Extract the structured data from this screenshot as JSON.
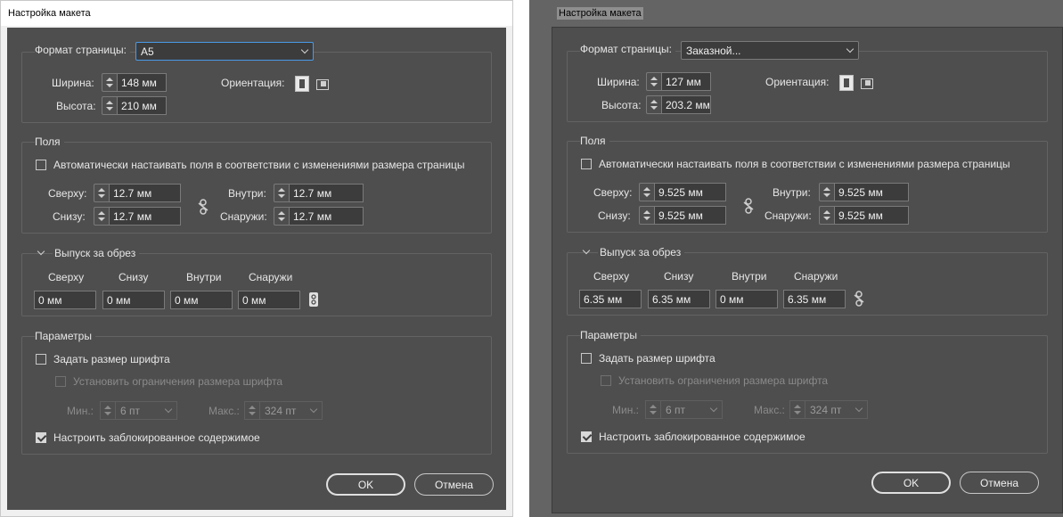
{
  "left": {
    "title": "Настройка макета",
    "page_format": {
      "label": "Формат страницы:",
      "value": "A5"
    },
    "width": {
      "label": "Ширина:",
      "value": "148 мм"
    },
    "height": {
      "label": "Высота:",
      "value": "210 мм"
    },
    "orientation": {
      "label": "Ориентация:"
    },
    "margins": {
      "title": "Поля",
      "auto_label": "Автоматически настаивать поля в соответствии с изменениями размера страницы",
      "top": {
        "label": "Сверху:",
        "value": "12.7 мм"
      },
      "bottom": {
        "label": "Снизу:",
        "value": "12.7 мм"
      },
      "inside": {
        "label": "Внутри:",
        "value": "12.7 мм"
      },
      "outside": {
        "label": "Снаружи:",
        "value": "12.7 мм"
      }
    },
    "bleed": {
      "title": "Выпуск за обрез",
      "cols": [
        "Сверху",
        "Снизу",
        "Внутри",
        "Снаружи"
      ],
      "values": [
        "0 мм",
        "0 мм",
        "0 мм",
        "0 мм"
      ]
    },
    "params": {
      "title": "Параметры",
      "set_font_size": "Задать размер шрифта",
      "limit_font": "Установить ограничения размера шрифта",
      "min_label": "Мин.:",
      "min_value": "6 пт",
      "max_label": "Макс.:",
      "max_value": "324 пт",
      "locked_content": "Настроить заблокированное содержимое"
    },
    "ok": "OK",
    "cancel": "Отмена"
  },
  "right": {
    "title": "Настройка макета",
    "page_format": {
      "label": "Формат страницы:",
      "value": "Заказной..."
    },
    "width": {
      "label": "Ширина:",
      "value": "127 мм"
    },
    "height": {
      "label": "Высота:",
      "value": "203.2 мм"
    },
    "orientation": {
      "label": "Ориентация:"
    },
    "margins": {
      "title": "Поля",
      "auto_label": "Автоматически настаивать поля в соответствии с изменениями размера страницы",
      "top": {
        "label": "Сверху:",
        "value": "9.525 мм"
      },
      "bottom": {
        "label": "Снизу:",
        "value": "9.525 мм"
      },
      "inside": {
        "label": "Внутри:",
        "value": "9.525 мм"
      },
      "outside": {
        "label": "Снаружи:",
        "value": "9.525 мм"
      }
    },
    "bleed": {
      "title": "Выпуск за обрез",
      "cols": [
        "Сверху",
        "Снизу",
        "Внутри",
        "Снаружи"
      ],
      "values": [
        "6.35 мм",
        "6.35 мм",
        "0 мм",
        "6.35 мм"
      ]
    },
    "params": {
      "title": "Параметры",
      "set_font_size": "Задать размер шрифта",
      "limit_font": "Установить ограничения размера шрифта",
      "min_label": "Мин.:",
      "min_value": "6 пт",
      "max_label": "Макс.:",
      "max_value": "324 пт",
      "locked_content": "Настроить заблокированное содержимое"
    },
    "ok": "OK",
    "cancel": "Отмена"
  },
  "icons": {
    "orientation_portrait": "portrait-orientation-icon",
    "orientation_landscape": "landscape-orientation-icon",
    "link": "chain-link-icon",
    "unlink": "broken-chain-icon"
  },
  "colors": {
    "panel": "#4e4e4e",
    "field": "#3c3c3c",
    "focus": "#4a9ae8"
  }
}
